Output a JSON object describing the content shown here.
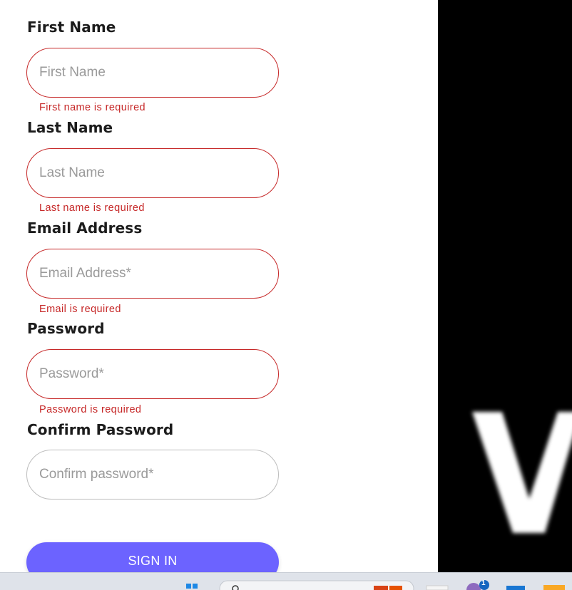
{
  "form": {
    "first_name": {
      "label": "First Name",
      "placeholder": "First Name",
      "error": "First name is required"
    },
    "last_name": {
      "label": "Last Name",
      "placeholder": "Last Name",
      "error": "Last name is required"
    },
    "email": {
      "label": "Email Address",
      "placeholder": "Email Address*",
      "error": "Email is required"
    },
    "password": {
      "label": "Password",
      "placeholder": "Password*",
      "error": "Password is required"
    },
    "confirm_password": {
      "label": "Confirm Password",
      "placeholder": "Confirm password*"
    },
    "submit_label": "SIGN IN"
  },
  "media_panel": {
    "letter": "V"
  },
  "taskbar": {
    "notification_count": "1",
    "icons": [
      "windows-start-icon",
      "search-bar-icon",
      "gift-icon",
      "widget-icon",
      "chat-app-icon",
      "code-editor-icon",
      "folder-icon"
    ]
  },
  "colors": {
    "accent": "#6c63ff",
    "error": "#c62828",
    "label_text": "#1c1c1c",
    "neutral_border": "#bdbdbd"
  }
}
